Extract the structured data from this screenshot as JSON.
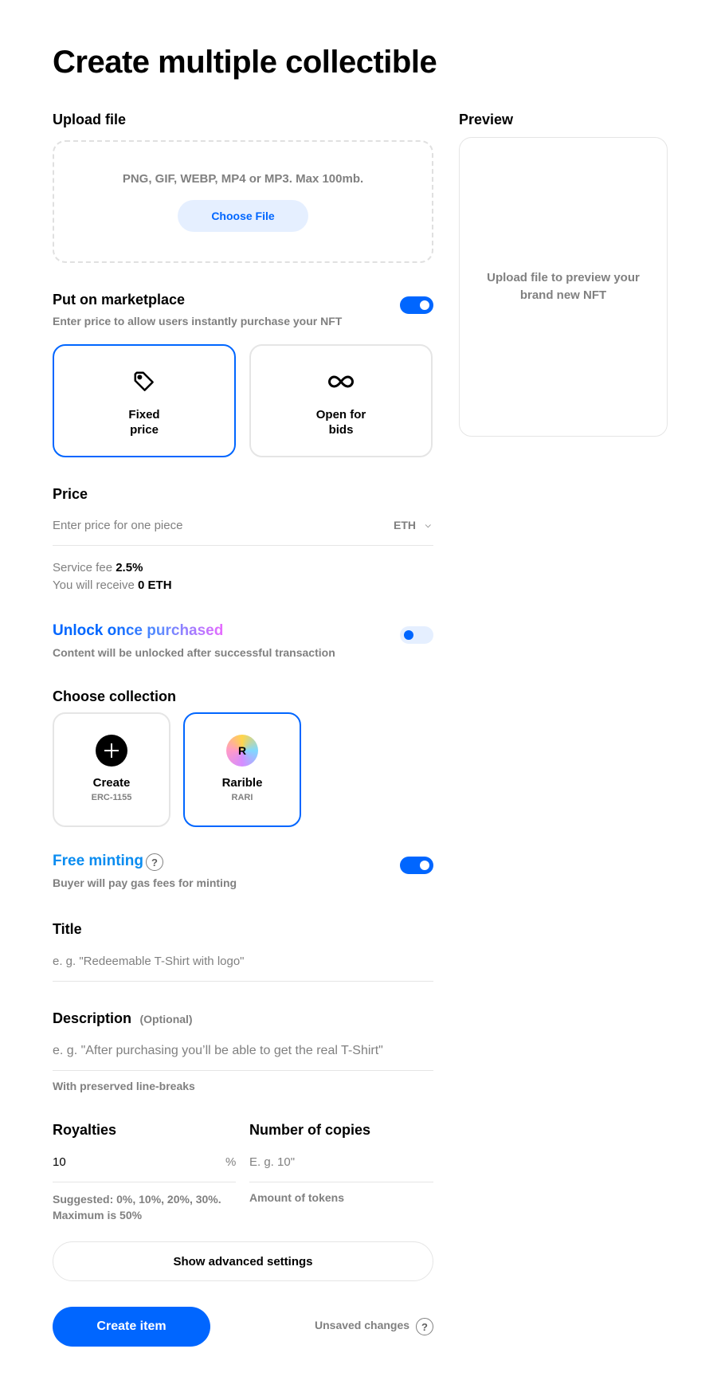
{
  "page": {
    "title": "Create multiple collectible"
  },
  "upload": {
    "label": "Upload file",
    "hint": "PNG, GIF, WEBP, MP4 or MP3. Max 100mb.",
    "button": "Choose File"
  },
  "preview": {
    "label": "Preview",
    "placeholder": "Upload file to preview your brand new NFT"
  },
  "marketplace": {
    "label": "Put on marketplace",
    "description": "Enter price to allow users instantly purchase your NFT",
    "enabled": true,
    "methods": [
      {
        "label": "Fixed price",
        "icon": "tag-icon",
        "selected": true
      },
      {
        "label": "Open for bids",
        "icon": "infinity-icon",
        "selected": false
      }
    ]
  },
  "price": {
    "label": "Price",
    "placeholder": "Enter price for one piece",
    "currency": "ETH",
    "service_fee_label": "Service fee",
    "service_fee_value": "2.5%",
    "receive_label": "You will receive",
    "receive_value": "0 ETH"
  },
  "unlock": {
    "label_part1": "Unlock",
    "label_part2": "once purchased",
    "description": "Content will be unlocked after successful transaction",
    "enabled": false
  },
  "collection": {
    "label": "Choose collection",
    "items": [
      {
        "name": "Create",
        "sub": "ERC-1155",
        "icon": "plus-icon",
        "selected": false
      },
      {
        "name": "Rarible",
        "sub": "RARI",
        "icon": "rarible-logo-icon",
        "selected": true,
        "icon_letter": "R"
      }
    ]
  },
  "free_minting": {
    "label": "Free minting",
    "help": "?",
    "description": "Buyer will pay gas fees for minting",
    "enabled": true
  },
  "title_field": {
    "label": "Title",
    "placeholder": "e. g. \"Redeemable T-Shirt with logo\""
  },
  "description_field": {
    "label": "Description",
    "optional": "(Optional)",
    "placeholder": "e. g. \"After purchasing you’ll be able to get the real T-Shirt\"",
    "hint": "With preserved line-breaks"
  },
  "royalties": {
    "label": "Royalties",
    "value": "10",
    "unit": "%",
    "hint_line1": "Suggested: 0%, 10%, 20%, 30%.",
    "hint_line2": "Maximum is 50%"
  },
  "copies": {
    "label": "Number of copies",
    "placeholder": "E. g. 10\"",
    "hint": "Amount of tokens"
  },
  "actions": {
    "advanced": "Show advanced settings",
    "create": "Create item",
    "unsaved": "Unsaved changes",
    "help": "?"
  },
  "colors": {
    "accent": "#0066ff",
    "accent_light": "#e5efff",
    "muted": "#808080",
    "border": "#e5e5e5"
  }
}
